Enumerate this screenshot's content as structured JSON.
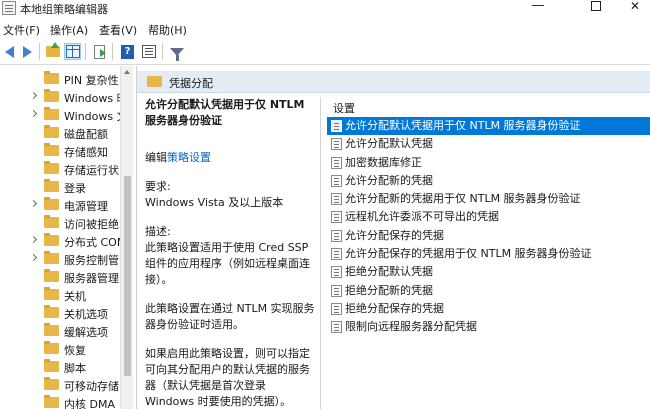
{
  "window": {
    "title": "本地组策略编辑器",
    "minimize": "—",
    "close": "✕"
  },
  "menu": [
    "文件(F)",
    "操作(A)",
    "查看(V)",
    "帮助(H)"
  ],
  "toolbar": [
    "back-icon",
    "forward-icon",
    "up-folder-icon",
    "show-hide-tree-icon",
    "export-list-icon",
    "help-icon",
    "properties-icon",
    "filter-icon"
  ],
  "tree": {
    "items": [
      {
        "label": "PIN 复杂性",
        "expandable": false
      },
      {
        "label": "Windows 时",
        "expandable": true
      },
      {
        "label": "Windows 文",
        "expandable": true
      },
      {
        "label": "磁盘配额",
        "expandable": false
      },
      {
        "label": "存储感知",
        "expandable": false
      },
      {
        "label": "存储运行状",
        "expandable": false
      },
      {
        "label": "登录",
        "expandable": false
      },
      {
        "label": "电源管理",
        "expandable": true
      },
      {
        "label": "访问被拒绝",
        "expandable": false
      },
      {
        "label": "分布式 COM",
        "expandable": true
      },
      {
        "label": "服务控制管",
        "expandable": true
      },
      {
        "label": "服务器管理",
        "expandable": false
      },
      {
        "label": "关机",
        "expandable": false
      },
      {
        "label": "关机选项",
        "expandable": false
      },
      {
        "label": "缓解选项",
        "expandable": false
      },
      {
        "label": "恢复",
        "expandable": false
      },
      {
        "label": "脚本",
        "expandable": false
      },
      {
        "label": "可移动存储",
        "expandable": false
      },
      {
        "label": "内核 DMA",
        "expandable": false
      }
    ]
  },
  "header": {
    "title": "凭据分配"
  },
  "description": {
    "heading": "允许分配默认凭据用于仅 NTLM 服务器身份验证",
    "edit_prefix": "编辑",
    "edit_link": "策略设置",
    "requirements_label": "要求:",
    "requirements_value": "Windows Vista 及以上版本",
    "desc_label": "描述:",
    "desc_p1": "此策略设置适用于使用 Cred SSP 组件的应用程序（例如远程桌面连接）。",
    "desc_p2": "此策略设置在通过 NTLM 实现服务器身份验证时适用。",
    "desc_p3": "如果启用此策略设置，则可以指定可向其分配用户的默认凭据的服务器（默认凭据是首次登录 Windows 时要使用的凭据）。"
  },
  "settings": {
    "column_header": "设置",
    "items": [
      {
        "label": "允许分配默认凭据用于仅 NTLM 服务器身份验证",
        "selected": true
      },
      {
        "label": "允许分配默认凭据",
        "selected": false
      },
      {
        "label": "加密数据库修正",
        "selected": false
      },
      {
        "label": "允许分配新的凭据",
        "selected": false
      },
      {
        "label": "允许分配新的凭据用于仅 NTLM 服务器身份验证",
        "selected": false
      },
      {
        "label": "远程机允许委派不可导出的凭据",
        "selected": false
      },
      {
        "label": "允许分配保存的凭据",
        "selected": false
      },
      {
        "label": "允许分配保存的凭据用于仅 NTLM 服务器身份验证",
        "selected": false
      },
      {
        "label": "拒绝分配默认凭据",
        "selected": false
      },
      {
        "label": "拒绝分配新的凭据",
        "selected": false
      },
      {
        "label": "拒绝分配保存的凭据",
        "selected": false
      },
      {
        "label": "限制向远程服务器分配凭据",
        "selected": false
      }
    ]
  },
  "colors": {
    "selection": "#0078d7",
    "link": "#0b65c2",
    "folder": "#e8b74a",
    "header_band": "#e4ecf5"
  }
}
